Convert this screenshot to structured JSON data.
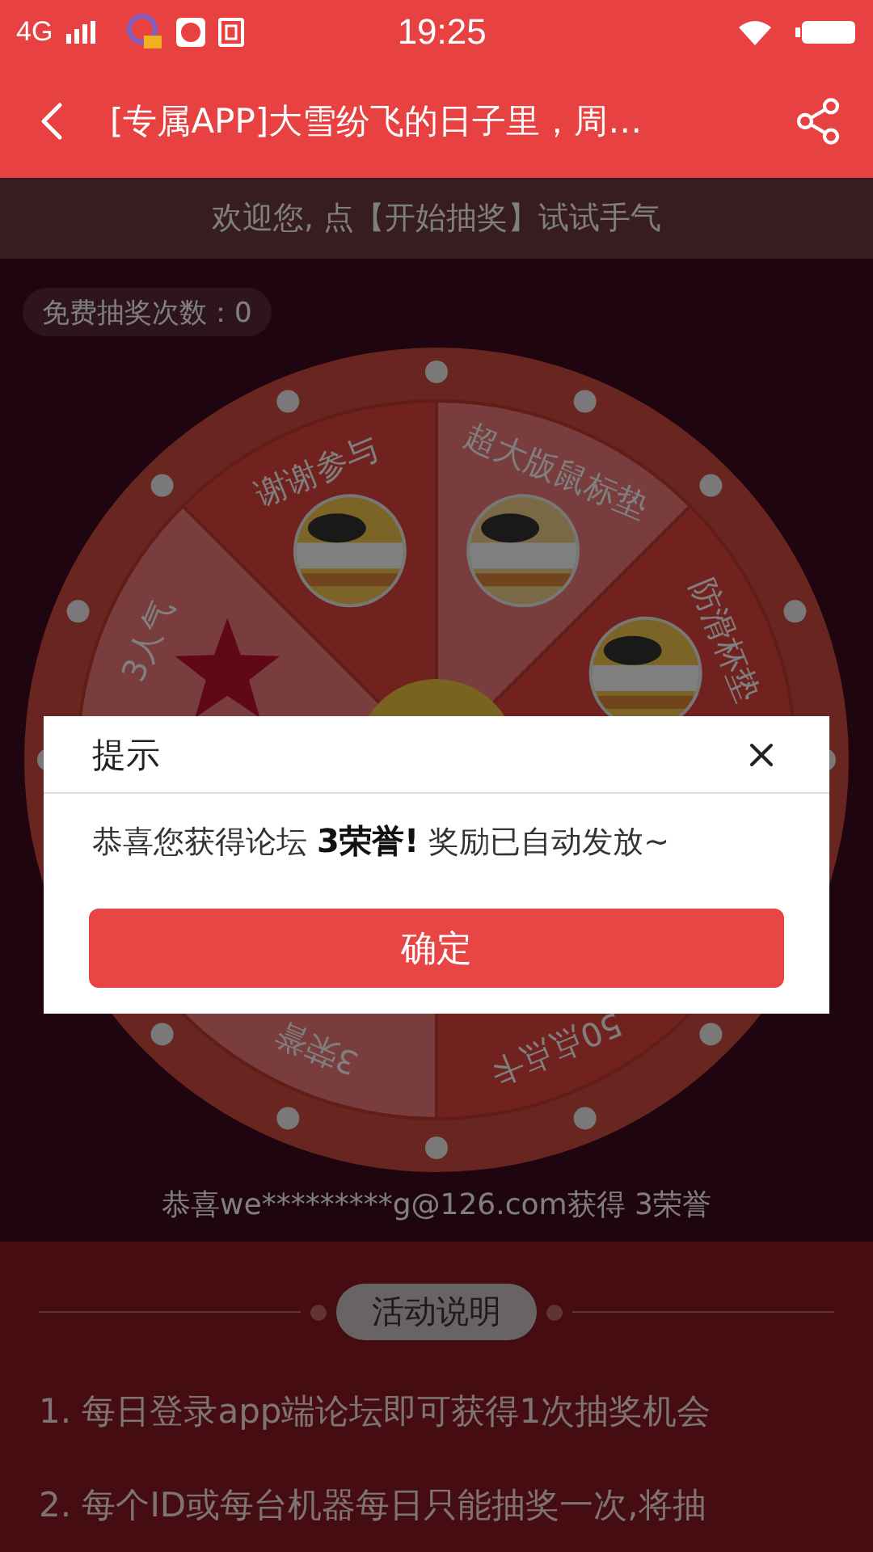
{
  "status_bar": {
    "network": "4G",
    "time": "19:25"
  },
  "header": {
    "title": "[专属APP]大雪纷飞的日子里，周…"
  },
  "welcome": "欢迎您, 点【开始抽奖】试试手气",
  "free_draws": "免费抽奖次数：0",
  "wheel": {
    "segments": [
      {
        "label": "谢谢参与",
        "kind": "picture"
      },
      {
        "label": "超大版鼠标垫",
        "kind": "picture"
      },
      {
        "label": "防滑杯垫",
        "kind": "picture"
      },
      {
        "label": "50点点卡",
        "kind": "plain"
      },
      {
        "label": "3荣誉",
        "kind": "plain"
      },
      {
        "label": "3人气",
        "kind": "star"
      }
    ]
  },
  "winner_notice": "恭喜we*********g@126.com获得 3荣誉",
  "rules": {
    "title": "活动说明",
    "items": [
      "1. 每日登录app端论坛即可获得1次抽奖机会",
      "2. 每个ID或每台机器每日只能抽奖一次,将抽"
    ]
  },
  "dialog": {
    "title": "提示",
    "message": "恭喜您获得论坛 **3荣誉!** 奖励已自动发放~",
    "confirm": "确定"
  }
}
